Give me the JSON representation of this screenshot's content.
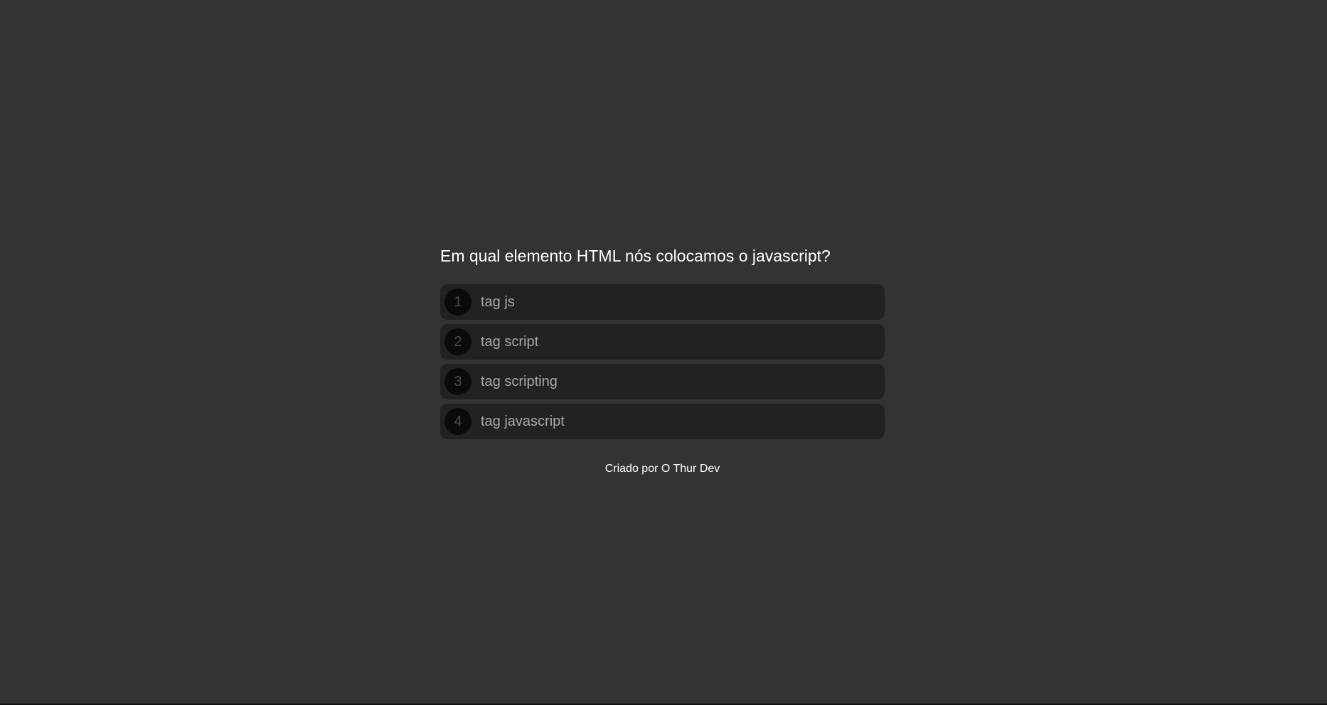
{
  "quiz": {
    "question": "Em qual elemento HTML nós colocamos o javascript?",
    "answers": [
      {
        "number": "1",
        "text": "tag js"
      },
      {
        "number": "2",
        "text": "tag script"
      },
      {
        "number": "3",
        "text": "tag scripting"
      },
      {
        "number": "4",
        "text": "tag javascript"
      }
    ]
  },
  "footer": {
    "text": "Criado por O Thur Dev"
  },
  "colors": {
    "background": "#333333",
    "answer_background": "#222222",
    "number_circle": "#0b0b0b",
    "answer_text": "#a9a9a9",
    "question_text": "#ffffff"
  }
}
